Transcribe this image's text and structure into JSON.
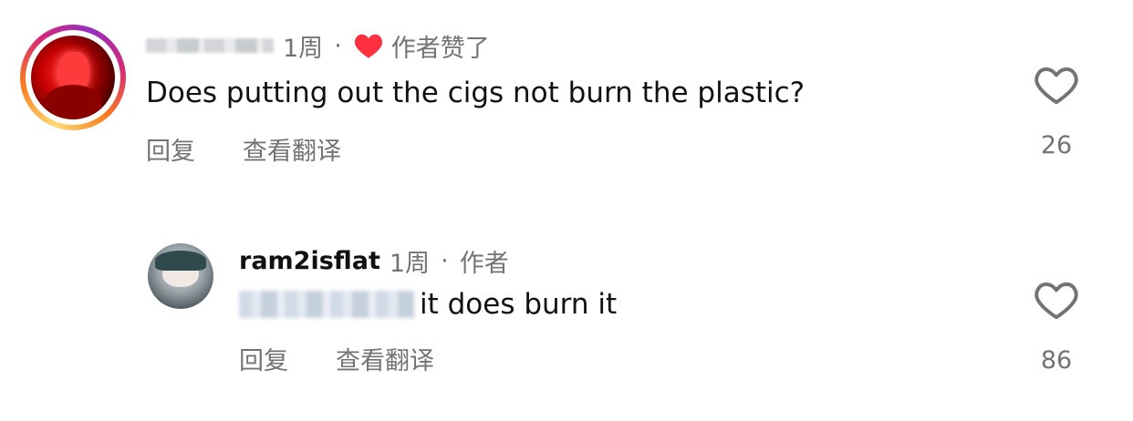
{
  "comments": [
    {
      "meta": {
        "time": "1周",
        "separator": "·",
        "liked_by_author": "作者赞了"
      },
      "text": "Does putting out the cigs not burn the plastic?",
      "actions": {
        "reply": "回复",
        "translate": "查看翻译"
      },
      "like_count": "26"
    },
    {
      "meta": {
        "username": "ram2isflat",
        "time": "1周",
        "separator": "·",
        "role": "作者"
      },
      "text": "it does burn it",
      "actions": {
        "reply": "回复",
        "translate": "查看翻译"
      },
      "like_count": "86"
    }
  ],
  "colors": {
    "heart_red": "#ff3040",
    "meta_gray": "#737373",
    "text": "#111111"
  },
  "icons": {
    "liked": "heart-filled-icon",
    "like": "heart-outline-icon"
  }
}
